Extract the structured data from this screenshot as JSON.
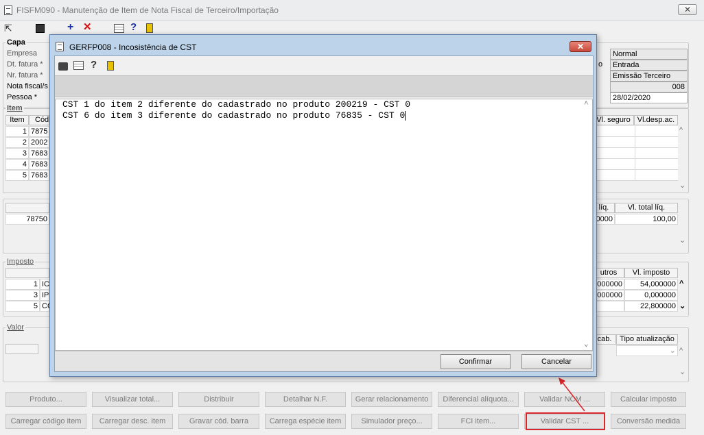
{
  "window": {
    "title": "FISFM090 - Manutenção de Item de Nota Fiscal de Terceiro/Importação"
  },
  "capa": {
    "label": "Capa",
    "fields": [
      "Empresa",
      "Dt. fatura *",
      "Nr. fatura *",
      "Nota fiscal/s",
      "Pessoa *"
    ],
    "partial_label": "o",
    "right_values": [
      "Normal",
      "Entrada",
      "Emissão Terceiro",
      "008",
      "28/02/2020"
    ]
  },
  "item": {
    "label": "Item",
    "headers": [
      "Item",
      "Cód",
      "Vl. seguro",
      "Vl.desp.ac."
    ],
    "rows": [
      {
        "num": "1",
        "code": "7875"
      },
      {
        "num": "2",
        "code": "2002"
      },
      {
        "num": "3",
        "code": "7683"
      },
      {
        "num": "4",
        "code": "7683"
      },
      {
        "num": "5",
        "code": "7683"
      }
    ]
  },
  "totals": {
    "headers": [
      "líq.",
      "Vl. total líq."
    ],
    "left_value": "78750",
    "values": [
      "0000",
      "100,00"
    ]
  },
  "imposto": {
    "label": "Imposto",
    "headers": [
      "utros",
      "Vl. imposto"
    ],
    "rows": [
      {
        "num": "1",
        "code": "ICM",
        "outros": ",000000",
        "valor": "54,000000"
      },
      {
        "num": "3",
        "code": "IPI",
        "outros": ",000000",
        "valor": "0,000000"
      },
      {
        "num": "5",
        "code": "CO",
        "outros": "",
        "valor": "22,800000"
      }
    ]
  },
  "valor": {
    "label": "Valor",
    "headers": [
      "cab.",
      "Tipo atualização"
    ]
  },
  "buttons_row1": [
    "Produto...",
    "Visualizar total...",
    "Distribuir",
    "Detalhar N.F.",
    "Gerar relacionamento",
    "Diferencial alíquota...",
    "Validar NCM ...",
    "Calcular imposto"
  ],
  "buttons_row2": [
    "Carregar código item",
    "Carregar desc. item",
    "Gravar cód. barra",
    "Carrega espécie item",
    "Simulador preço...",
    "FCI item...",
    "Validar CST ...",
    "Conversão medida"
  ],
  "dialog": {
    "title": "GERFP008 - Incosistência de CST",
    "lines": [
      "CST 1 do item 2 diferente do cadastrado no produto 200219 - CST 0",
      "CST 6 do item 3 diferente do cadastrado no produto 76835 - CST 0"
    ],
    "confirm_label": "Confirmar",
    "cancel_label": "Cancelar"
  },
  "colors": {
    "highlight": "#d9262b",
    "dialog_frame": "#bdd3ea",
    "close_red": "#c8493a"
  }
}
